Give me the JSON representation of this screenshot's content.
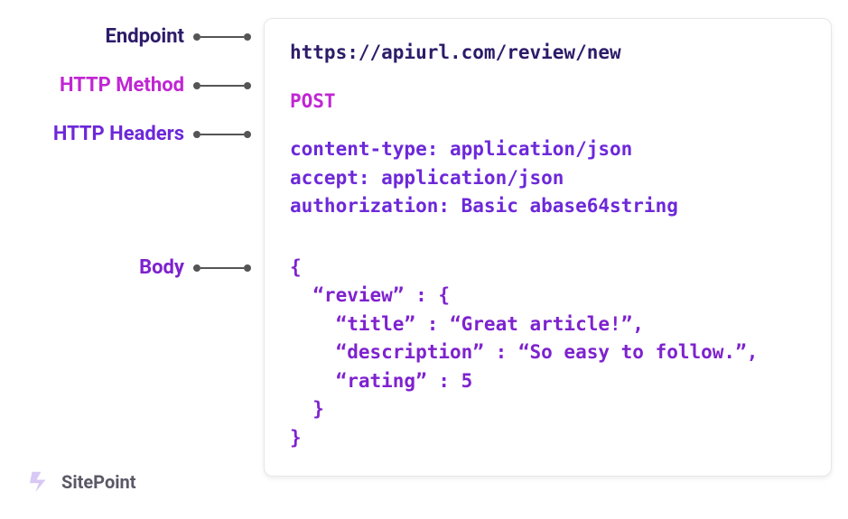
{
  "labels": {
    "endpoint": "Endpoint",
    "method": "HTTP Method",
    "headers": "HTTP Headers",
    "body": "Body"
  },
  "request": {
    "url": "https://apiurl.com/review/new",
    "method": "POST",
    "headers": [
      "content-type: application/json",
      "accept: application/json",
      "authorization: Basic abase64string"
    ],
    "bodyLines": [
      "{",
      "  “review” : {",
      "    “title” : “Great article!”,",
      "    “description” : “So easy to follow.”,",
      "    “rating” : 5",
      "  }",
      "}"
    ]
  },
  "brand": {
    "name": "SitePoint"
  }
}
